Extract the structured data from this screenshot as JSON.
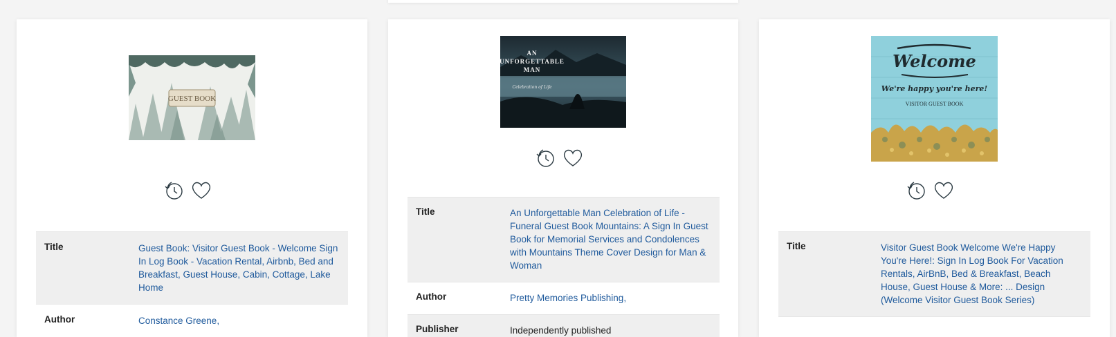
{
  "icons": {
    "history": "history-clock-icon",
    "favorite": "heart-outline-icon"
  },
  "colors": {
    "link": "#1f5a9c",
    "label": "#222222",
    "row_shade": "#efefef",
    "page_bg": "#f4f4f4"
  },
  "cards": [
    {
      "cover_text": "GUEST BOOK",
      "rows": [
        {
          "label": "Title",
          "value": "Guest Book: Visitor Guest Book - Welcome Sign In Log Book - Vacation Rental, Airbnb, Bed and Breakfast, Guest House, Cabin, Cottage, Lake Home"
        },
        {
          "label": "Author",
          "value": "Constance Greene,"
        }
      ]
    },
    {
      "cover_text": {
        "line1": "AN",
        "line2": "UNFORGETTABLE",
        "line3": "MAN",
        "script": "Celebration of Life"
      },
      "rows": [
        {
          "label": "Title",
          "value": "An Unforgettable Man Celebration of Life - Funeral Guest Book Mountains: A Sign In Guest Book for Memorial Services and Condolences with Mountains Theme Cover Design for Man & Woman"
        },
        {
          "label": "Author",
          "value": "Pretty Memories Publishing,"
        },
        {
          "label": "Publisher",
          "value": "Independently published"
        }
      ]
    },
    {
      "cover_text": {
        "welcome": "Welcome",
        "tagline": "We're happy you're here!",
        "subtitle": "VISITOR GUEST BOOK"
      },
      "rows": [
        {
          "label": "Title",
          "value": "Visitor Guest Book Welcome We're Happy You're Here!: Sign In Log Book For Vacation Rentals, AirBnB, Bed & Breakfast, Beach House, Guest House & More: ... Design (Welcome Visitor Guest Book Series)"
        }
      ]
    }
  ]
}
